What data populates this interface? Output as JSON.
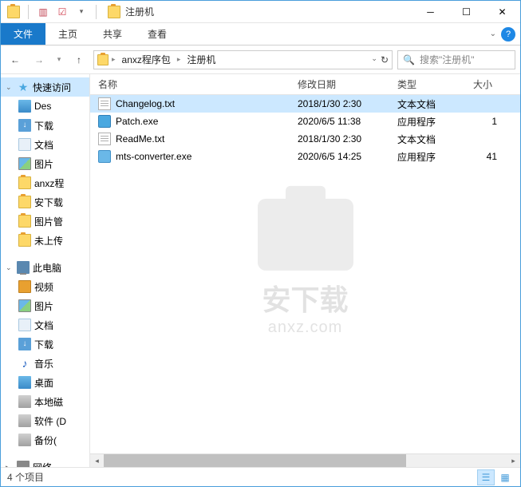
{
  "window": {
    "title": "注册机"
  },
  "ribbon": {
    "file": "文件",
    "tabs": [
      "主页",
      "共享",
      "查看"
    ]
  },
  "breadcrumb": {
    "items": [
      "anxz程序包",
      "注册机"
    ]
  },
  "search": {
    "placeholder": "搜索\"注册机\""
  },
  "sidebar": {
    "quick": {
      "label": "快速访问",
      "items": [
        {
          "label": "Des",
          "icon": "desktop"
        },
        {
          "label": "下载",
          "icon": "download"
        },
        {
          "label": "文档",
          "icon": "doc"
        },
        {
          "label": "图片",
          "icon": "pic"
        },
        {
          "label": "anxz程",
          "icon": "folder"
        },
        {
          "label": "安下载",
          "icon": "folder"
        },
        {
          "label": "图片管",
          "icon": "folder"
        },
        {
          "label": "未上传",
          "icon": "folder"
        }
      ]
    },
    "pc": {
      "label": "此电脑",
      "items": [
        {
          "label": "视频",
          "icon": "video"
        },
        {
          "label": "图片",
          "icon": "pic"
        },
        {
          "label": "文档",
          "icon": "doc"
        },
        {
          "label": "下载",
          "icon": "download"
        },
        {
          "label": "音乐",
          "icon": "music"
        },
        {
          "label": "桌面",
          "icon": "desktop"
        },
        {
          "label": "本地磁",
          "icon": "disk"
        },
        {
          "label": "软件 (D",
          "icon": "disk"
        },
        {
          "label": "备份(",
          "icon": "disk"
        }
      ]
    },
    "net": {
      "label": "网络"
    }
  },
  "columns": {
    "name": "名称",
    "date": "修改日期",
    "type": "类型",
    "size": "大小"
  },
  "files": [
    {
      "name": "Changelog.txt",
      "date": "2018/1/30 2:30",
      "type": "文本文档",
      "size": "",
      "icon": "txt"
    },
    {
      "name": "Patch.exe",
      "date": "2020/6/5 11:38",
      "type": "应用程序",
      "size": "1",
      "icon": "exe"
    },
    {
      "name": "ReadMe.txt",
      "date": "2018/1/30 2:30",
      "type": "文本文档",
      "size": "",
      "icon": "txt"
    },
    {
      "name": "mts-converter.exe",
      "date": "2020/6/5 14:25",
      "type": "应用程序",
      "size": "41",
      "icon": "exe2"
    }
  ],
  "watermark": {
    "line1": "安下载",
    "line2": "anxz.com"
  },
  "status": {
    "text": "4 个项目"
  }
}
